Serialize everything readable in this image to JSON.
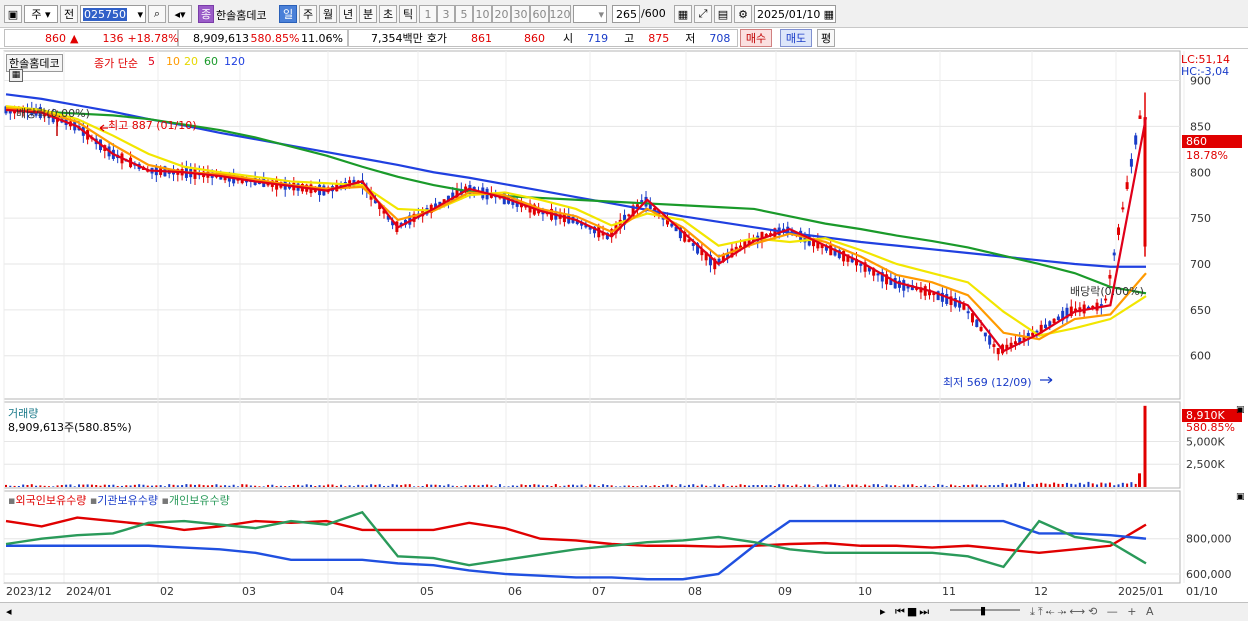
{
  "toolbar": {
    "period_label": "주",
    "prev_label": "전",
    "code": "025750",
    "name_badge": "종",
    "stock_name": "한솔홈데코",
    "interval_tabs": [
      "일",
      "주",
      "월",
      "년",
      "분",
      "초",
      "틱"
    ],
    "active_interval": "일",
    "step_buttons": [
      "1",
      "3",
      "5",
      "10",
      "20",
      "30",
      "60",
      "120"
    ],
    "count": "265",
    "count_max": "/600",
    "date": "2025/01/10"
  },
  "quote": {
    "price": "860",
    "arrow": "▲",
    "change": "136",
    "change_pct": "+18.78%",
    "volume": "8,909,613",
    "vol_ratio": "580.85%",
    "turnover": "11.06%",
    "amount": "7,354백만",
    "hoga_label": "호가",
    "ask": "861",
    "bid": "860",
    "open_label": "시",
    "open": "719",
    "high_label": "고",
    "high": "875",
    "low_label": "저",
    "low": "708",
    "buy_label": "매수",
    "sell_label": "매도",
    "eval_label": "평"
  },
  "price_panel": {
    "title": "한솔홈데코",
    "ma_title": "종가 단순",
    "ma_periods": [
      "5",
      "10",
      "20",
      "60",
      "120"
    ],
    "ma_colors": [
      "#e0001a",
      "#ff9a00",
      "#f2e600",
      "#1a9a2a",
      "#2040e0"
    ],
    "lc_label": "LC:51,14",
    "hc_label": "HC:-3,04",
    "current_price_label": "860",
    "current_pct_label": "18.78%",
    "dividend_label_1": "배당락(0.00%)",
    "dividend_label_2": "배당락(0.00%)",
    "high_marker": "최고 887 (01/10)",
    "low_marker": "최저 569 (12/09)",
    "y_ticks": [
      "900",
      "850",
      "800",
      "750",
      "700",
      "650",
      "600"
    ]
  },
  "volume_panel": {
    "title": "거래량",
    "summary": "8,909,613주(580.85%)",
    "current_label": "8,910K",
    "current_pct": "580.85%",
    "y_ticks": [
      "5,000K",
      "2,500K"
    ]
  },
  "holdings_panel": {
    "legend": [
      "외국인보유수량",
      "기관보유수량",
      "개인보유수량"
    ],
    "colors": [
      "#e00000",
      "#2050e0",
      "#2a9a5a"
    ],
    "y_ticks": [
      "800,000",
      "600,000"
    ]
  },
  "x_axis": {
    "labels": [
      "2023/12",
      "2024/01",
      "02",
      "03",
      "04",
      "05",
      "06",
      "07",
      "08",
      "09",
      "10",
      "11",
      "12",
      "2025/01",
      "01/10"
    ]
  },
  "chart_data": {
    "type": "line",
    "series": [
      {
        "name": "120",
        "values": [
          885,
          880,
          873,
          866,
          858,
          851,
          843,
          836,
          829,
          822,
          815,
          808,
          800,
          794,
          787,
          780,
          773,
          766,
          759,
          752,
          746,
          740,
          734,
          729,
          724,
          720,
          716,
          712,
          708,
          704,
          700,
          697,
          697
        ]
      },
      {
        "name": "60",
        "values": [
          868,
          866,
          864,
          862,
          858,
          852,
          846,
          838,
          828,
          818,
          806,
          795,
          786,
          779,
          774,
          772,
          770,
          768,
          766,
          764,
          762,
          760,
          752,
          744,
          738,
          731,
          725,
          718,
          709,
          700,
          690,
          675,
          668
        ]
      },
      {
        "name": "20",
        "values": [
          872,
          868,
          858,
          840,
          820,
          806,
          800,
          795,
          790,
          788,
          786,
          760,
          758,
          775,
          778,
          770,
          760,
          742,
          755,
          748,
          720,
          728,
          724,
          728,
          715,
          700,
          690,
          680,
          648,
          622,
          630,
          640,
          665
        ]
      },
      {
        "name": "10",
        "values": [
          870,
          866,
          855,
          830,
          808,
          800,
          798,
          792,
          786,
          782,
          784,
          748,
          758,
          778,
          775,
          760,
          752,
          735,
          760,
          740,
          708,
          722,
          733,
          724,
          708,
          688,
          680,
          666,
          625,
          618,
          640,
          645,
          690
        ]
      },
      {
        "name": "5",
        "values": [
          868,
          865,
          850,
          820,
          802,
          800,
          796,
          790,
          785,
          780,
          790,
          740,
          760,
          782,
          772,
          758,
          748,
          730,
          770,
          735,
          700,
          725,
          738,
          720,
          702,
          680,
          670,
          655,
          605,
          624,
          648,
          655,
          860
        ]
      }
    ],
    "ylim": [
      555,
      930
    ],
    "volume_current": 8910,
    "volume_ylim": [
      0,
      9000
    ],
    "holdings": [
      {
        "name": "외국인보유수량",
        "values": [
          900,
          870,
          920,
          900,
          880,
          850,
          870,
          900,
          890,
          900,
          850,
          850,
          850,
          890,
          860,
          800,
          790,
          770,
          760,
          760,
          755,
          760,
          770,
          775,
          760,
          760,
          750,
          760,
          740,
          720,
          740,
          760,
          880
        ]
      },
      {
        "name": "기관보유수량",
        "values": [
          760,
          760,
          760,
          760,
          760,
          750,
          740,
          720,
          680,
          680,
          680,
          660,
          650,
          620,
          600,
          590,
          580,
          580,
          570,
          570,
          600,
          760,
          900,
          900,
          900,
          900,
          900,
          900,
          900,
          830,
          830,
          820,
          800
        ]
      },
      {
        "name": "개인보유수량",
        "values": [
          770,
          800,
          820,
          830,
          890,
          900,
          880,
          860,
          900,
          880,
          950,
          700,
          690,
          650,
          680,
          710,
          740,
          760,
          780,
          790,
          810,
          780,
          740,
          720,
          720,
          720,
          720,
          700,
          640,
          900,
          810,
          780,
          660
        ]
      }
    ],
    "holdings_ylim": [
      560,
      980
    ]
  }
}
